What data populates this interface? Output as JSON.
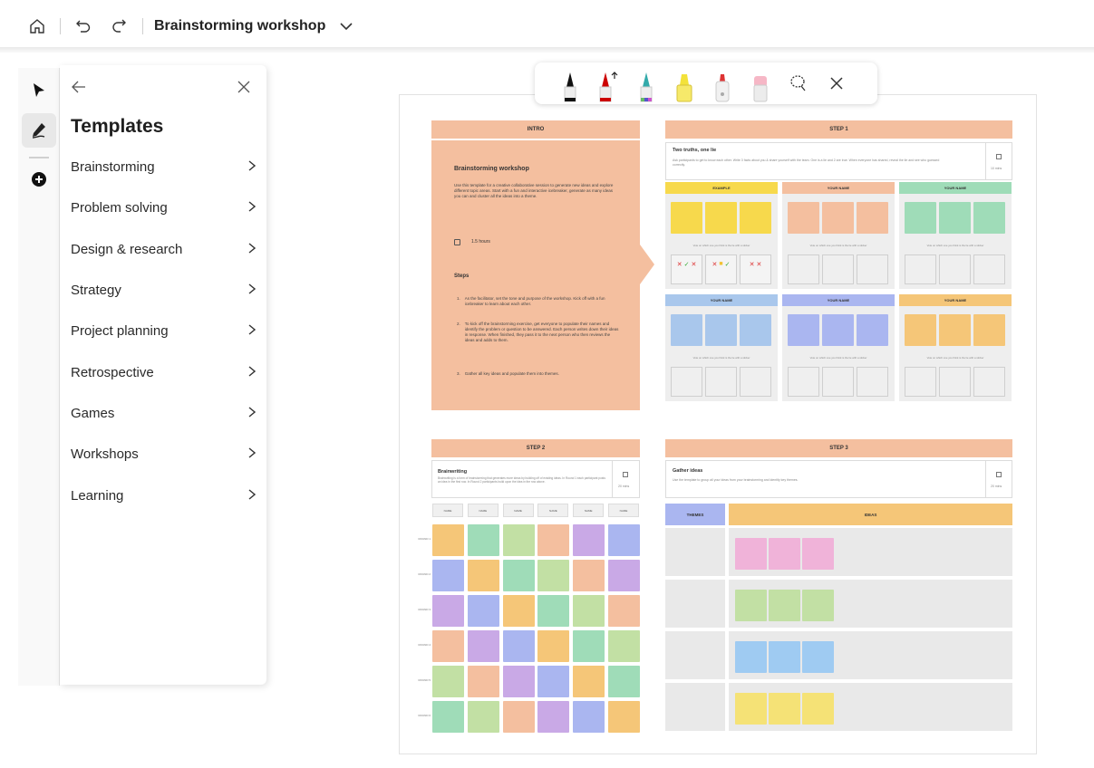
{
  "topbar": {
    "home_icon": "home-icon",
    "undo_icon": "undo-icon",
    "redo_icon": "redo-icon",
    "title": "Brainstorming workshop",
    "chevron_icon": "chevron-down-icon"
  },
  "rail": {
    "tools": [
      "select-icon",
      "pen-icon",
      "add-icon"
    ]
  },
  "panel": {
    "title": "Templates",
    "back_icon": "back-arrow-icon",
    "close_icon": "close-icon",
    "categories": [
      {
        "label": "Brainstorming"
      },
      {
        "label": "Problem solving"
      },
      {
        "label": "Design & research"
      },
      {
        "label": "Strategy"
      },
      {
        "label": "Project planning"
      },
      {
        "label": "Retrospective"
      },
      {
        "label": "Games"
      },
      {
        "label": "Workshops"
      },
      {
        "label": "Learning"
      }
    ]
  },
  "ink_toolbar": {
    "tools": [
      "black-pen",
      "red-pen",
      "rainbow-pen",
      "yellow-highlighter",
      "white-marker",
      "eraser",
      "lasso-select",
      "close"
    ]
  },
  "board": {
    "intro": {
      "header": "INTRO",
      "heading": "Brainstorming workshop",
      "body": "Use this template for a creative collaborative session to generate new ideas and explore different topic areas. Start with a fun and interactive icebreaker, generate as many ideas you can and cluster all the ideas into a theme.",
      "duration": "1.5 hours",
      "steps_heading": "Steps",
      "steps": [
        "As the facilitator, set the tone and purpose of the workshop. Kick off with a fun icebreaker to learn about each other.",
        "To kick off the brainstorming exercise, get everyone to populate their names and identify the problem or question to be answered. Each person writes down their ideas in response. When finished, they pass it to the next person who then reviews the ideas and adds to them.",
        "Gather all key ideas and populate them into themes."
      ]
    },
    "step1": {
      "header": "STEP 1",
      "card_title": "Two truths, one lie",
      "card_body": "Ask participants to get to know each other. Write 3 facts about you & share yourself with the team. One is a lie and 2 are true. When everyone has shared, reveal the lie and see who guessed correctly.",
      "card_time": "10 mins",
      "panels": [
        {
          "label": "EXAMPLE",
          "color": "#f7d94c"
        },
        {
          "label": "YOUR NAME",
          "color": "#f4bf9f"
        },
        {
          "label": "YOUR NAME",
          "color": "#9fdcb8"
        },
        {
          "label": "YOUR NAME",
          "color": "#a9c7ec"
        },
        {
          "label": "YOUR NAME",
          "color": "#aab6f0"
        },
        {
          "label": "YOUR NAME",
          "color": "#f5c678"
        }
      ],
      "caption": "Vote on which one you think is the lie with a sticker"
    },
    "step2": {
      "header": "STEP 2",
      "card_title": "Brainwriting",
      "card_body": "Brainwriting is a form of brainstorming that generates more ideas by building off of existing ideas. In Round 1 each participant posts an idea in the first row. In Round 2 participants build upon the idea in the row above.",
      "card_time": "20 mins",
      "names": [
        "NAME",
        "NAME",
        "NAME",
        "NAME",
        "NAME",
        "NAME"
      ],
      "rounds": [
        "ROUND 1",
        "ROUND 2",
        "ROUND 3",
        "ROUND 4",
        "ROUND 5",
        "ROUND 6"
      ]
    },
    "step3": {
      "header": "STEP 3",
      "card_title": "Gather ideas",
      "card_body": "Use the template to group all your ideas from your brainstorming and identify key themes.",
      "card_time": "20 mins",
      "themes_label": "THEMES",
      "ideas_label": "IDEAS"
    }
  },
  "colors": {
    "peach": "#f4bf9f",
    "yellow": "#f7d94c",
    "green": "#9fdcb8",
    "blue": "#a9c7ec",
    "lavender": "#aab6f0",
    "orange": "#f5c678",
    "pink": "#f0b3d9",
    "lime": "#c2e0a4",
    "sky": "#9fcbf2",
    "lemon": "#f5e276"
  }
}
